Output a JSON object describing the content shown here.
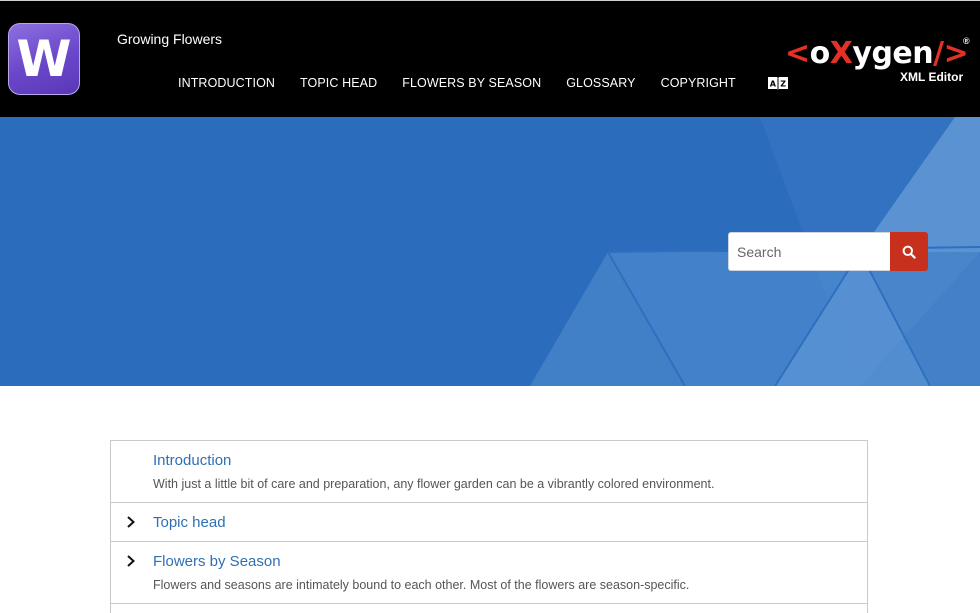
{
  "header": {
    "app_logo_letter": "W",
    "site_title": "Growing Flowers",
    "nav": [
      {
        "label": "INTRODUCTION"
      },
      {
        "label": "TOPIC HEAD"
      },
      {
        "label": "FLOWERS BY SEASON"
      },
      {
        "label": "GLOSSARY"
      },
      {
        "label": "COPYRIGHT"
      }
    ],
    "index_icon": "a-z-book-icon",
    "brand": {
      "open": "<",
      "o1": "o",
      "x": "X",
      "ygen": "ygen",
      "close": "/>",
      "reg": "®",
      "sub": "XML Editor"
    }
  },
  "hero": {
    "search": {
      "placeholder": "Search",
      "value": "",
      "button_icon": "search-icon"
    }
  },
  "topics": [
    {
      "title": "Introduction",
      "desc": "With just a little bit of care and preparation, any flower garden can be a vibrantly colored environment.",
      "expandable": false
    },
    {
      "title": "Topic head",
      "desc": "",
      "expandable": true
    },
    {
      "title": "Flowers by Season",
      "desc": "Flowers and seasons are intimately bound to each other. Most of the flowers are season-specific.",
      "expandable": true
    }
  ],
  "colors": {
    "header_bg": "#000000",
    "hero_bg": "#2b6cbd",
    "search_button": "#c7301d",
    "link": "#2f6fb5",
    "brand_red": "#e53125"
  }
}
